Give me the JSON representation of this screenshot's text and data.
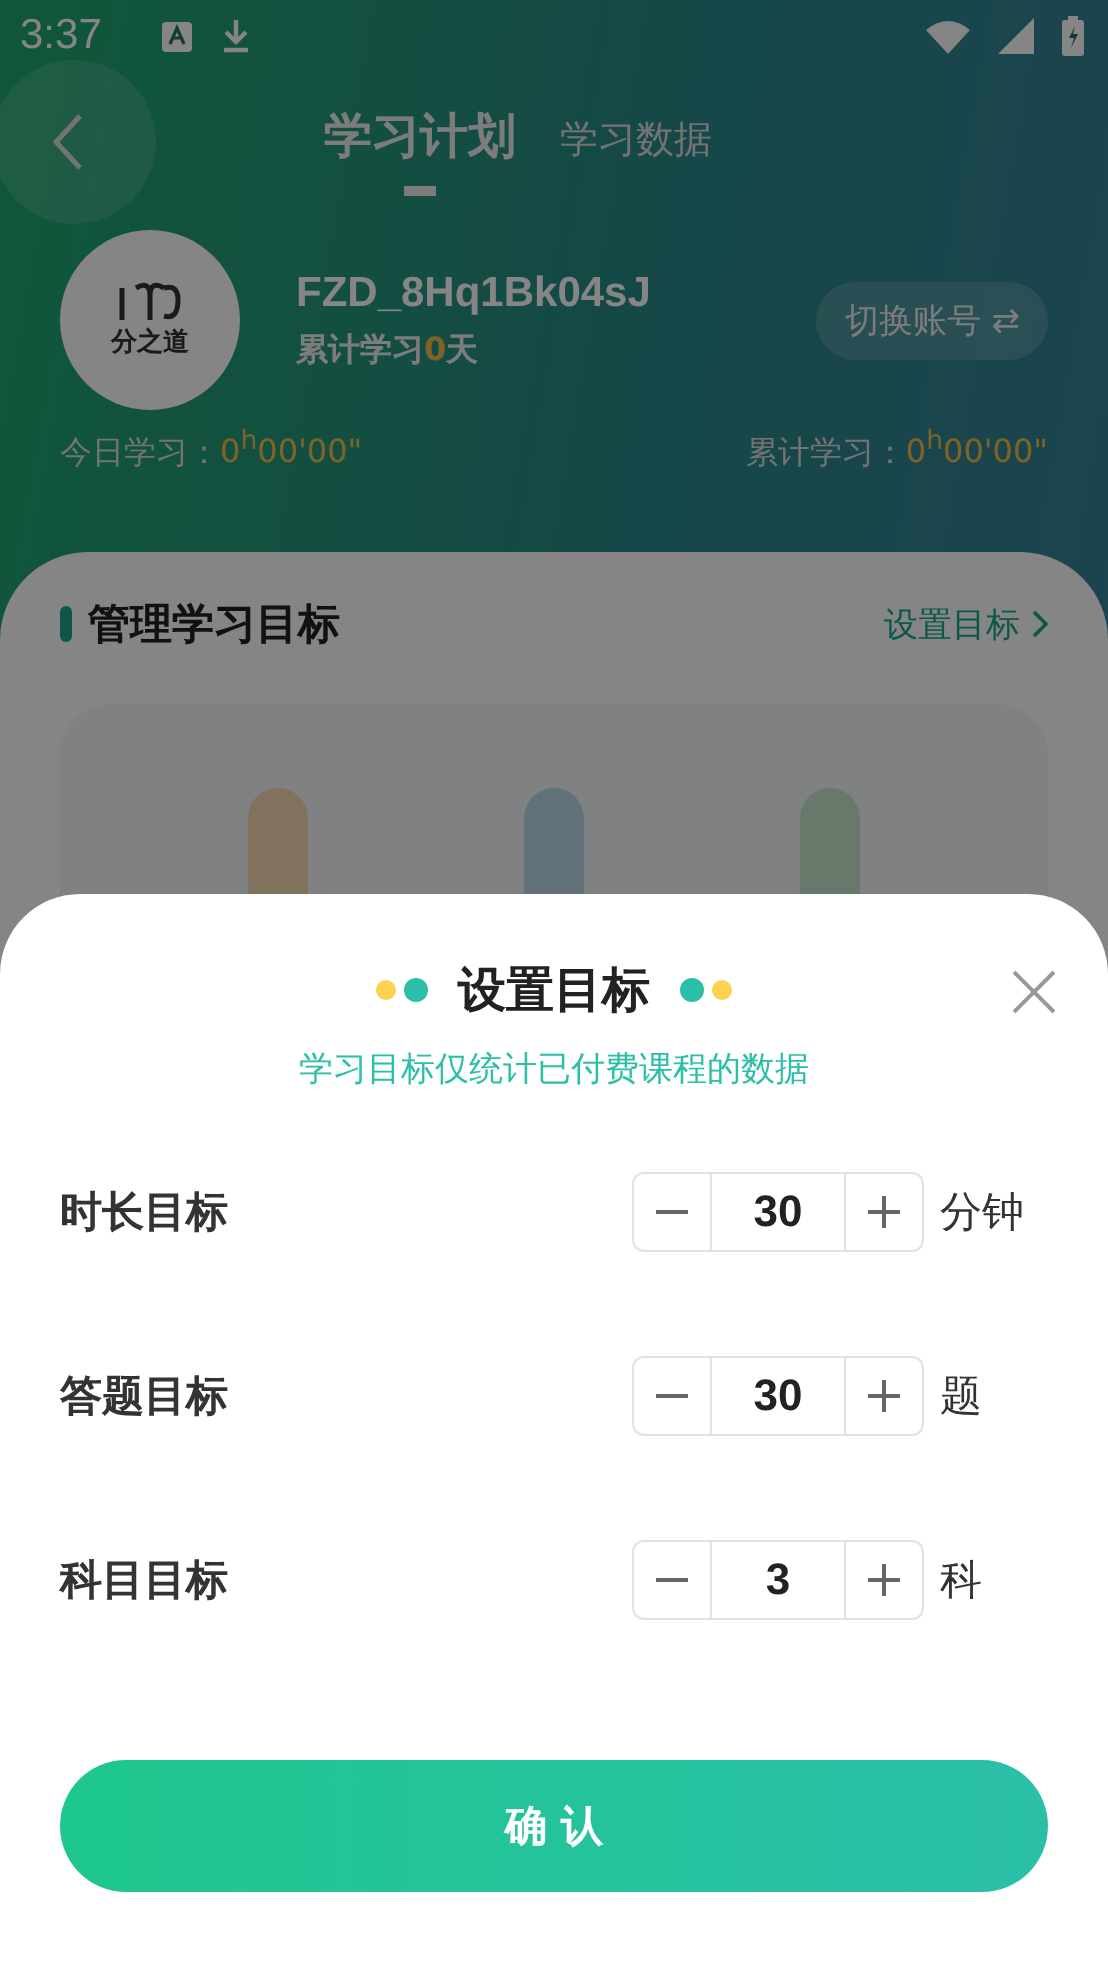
{
  "status_bar": {
    "time": "3:37"
  },
  "header": {
    "tabs": [
      {
        "label": "学习计划",
        "selected": true
      },
      {
        "label": "学习数据",
        "selected": false
      }
    ]
  },
  "profile": {
    "logo_text": "分之道",
    "username": "FZD_8Hq1Bk04sJ",
    "days_prefix": "累计学习",
    "days_value": "0",
    "days_suffix": "天",
    "switch_label": "切换账号 ⇄"
  },
  "stats": [
    {
      "label": "今日学习：",
      "value": "0$^{h}$00'00\""
    },
    {
      "label": "累计学习：",
      "value": "0$^{h}$00'00\""
    }
  ],
  "goals_card": {
    "title": "管理学习目标",
    "link": "设置目标"
  },
  "dialog": {
    "title": "设置目标",
    "subtitle": "学习目标仅统计已付费课程的数据",
    "rows": [
      {
        "label": "时长目标",
        "value": "30",
        "unit": "分钟"
      },
      {
        "label": "答题目标",
        "value": "30",
        "unit": "题"
      },
      {
        "label": "科目目标",
        "value": "3",
        "unit": "科"
      }
    ],
    "confirm": "确 认"
  }
}
